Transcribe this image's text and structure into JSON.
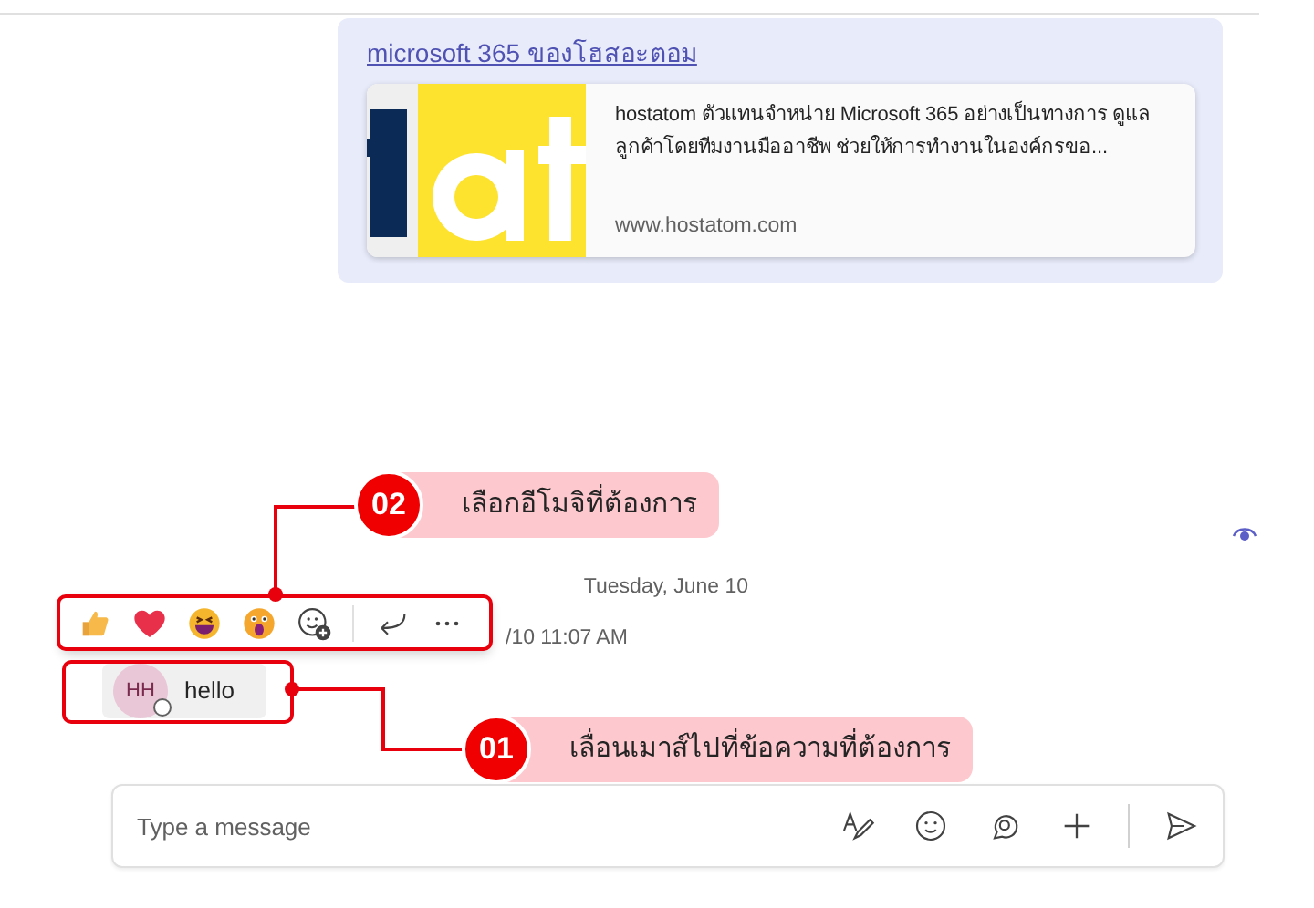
{
  "link_message": {
    "link": "microsoft 365 ของโฮสอะตอม",
    "preview": {
      "description": "hostatom ตัวแทนจำหน่าย Microsoft 365 อย่างเป็นทางการ ดูแลลูกค้าโดยทีมงานมืออาชีพ ช่วยให้การทำงานในองค์กรขอ...",
      "domain": "www.hostatom.com"
    }
  },
  "date_divider": "Tuesday, June 10",
  "timestamp": "/10 11:07 AM",
  "reaction_bar": [
    {
      "kind": "like"
    },
    {
      "kind": "heart"
    },
    {
      "kind": "laugh"
    },
    {
      "kind": "surprised"
    },
    {
      "kind": "add-reaction"
    },
    {
      "kind": "divider"
    },
    {
      "kind": "reply"
    },
    {
      "kind": "more"
    }
  ],
  "message": {
    "avatar": "HH",
    "text": "hello"
  },
  "compose": {
    "placeholder": "Type a message",
    "tools": [
      {
        "kind": "format"
      },
      {
        "kind": "emoji"
      },
      {
        "kind": "loop"
      },
      {
        "kind": "attach"
      },
      {
        "kind": "divider"
      },
      {
        "kind": "send"
      }
    ]
  },
  "callouts": [
    {
      "number": "02",
      "text": "เลือกอีโมจิที่ต้องการ"
    },
    {
      "number": "01",
      "text": "เลื่อนเมาส์ไปที่ข้อความที่ต้องการ"
    }
  ]
}
